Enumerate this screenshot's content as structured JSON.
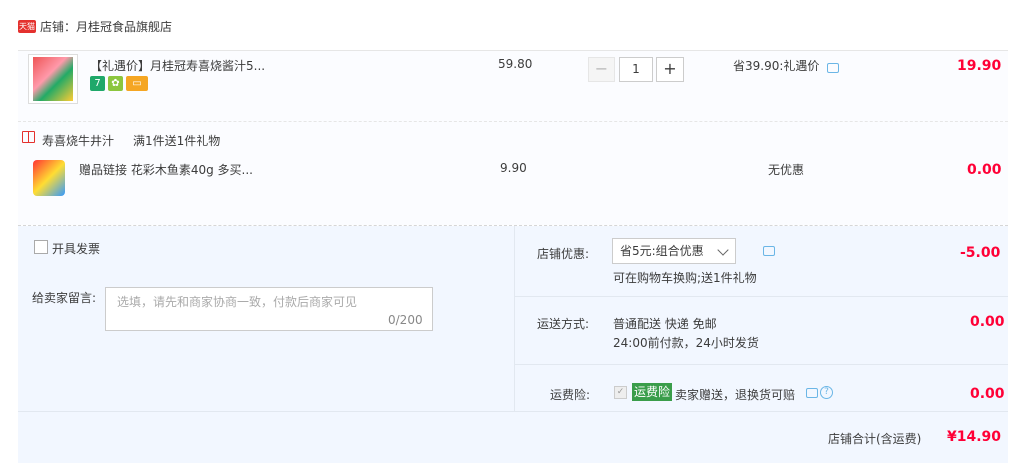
{
  "shop": {
    "badge": "天猫",
    "name": "店铺：月桂冠食品旗舰店"
  },
  "items": [
    {
      "title": "【礼遇价】月桂冠寿喜烧酱汁5...",
      "price": "59.80",
      "quantity": "1",
      "discount": "省39.90:礼遇价",
      "subtotal": "19.90",
      "tags": [
        "7",
        "gift",
        "card"
      ]
    },
    {
      "title": "赠品链接 花彩木鱼素40g 多买...",
      "price": "9.90",
      "discount": "无优惠",
      "subtotal": "0.00"
    }
  ],
  "gift_promo": {
    "name": "寿喜烧牛井汁",
    "rule": "满1件送1件礼物"
  },
  "qty": {
    "minus": "−",
    "plus": "+"
  },
  "order": {
    "invoice_label": "开具发票",
    "memo_label": "给卖家留言:",
    "memo_placeholder": "选填，请先和商家协商一致，付款后商家可见",
    "memo_count": "0/200",
    "shop_discount_label": "店铺优惠:",
    "shop_discount_value": "省5元:组合优惠",
    "shop_discount_note": "可在购物车换购;送1件礼物",
    "shop_discount_amount": "-5.00",
    "shipping_label": "运送方式:",
    "shipping_line1": "普通配送 快递 免邮",
    "shipping_line2": "24:00前付款，24小时发货",
    "shipping_amount": "0.00",
    "insurance_label": "运费险:",
    "insurance_badge": "运费险",
    "insurance_text": "卖家赠送，退换货可赔",
    "insurance_amount": "0.00",
    "total_label": "店铺合计(含运费)",
    "total_value": "¥14.90"
  },
  "colors": {
    "accent_red": "#ff0036",
    "tmall_red": "#e4312e",
    "insurance_green": "#3a9d4a"
  }
}
